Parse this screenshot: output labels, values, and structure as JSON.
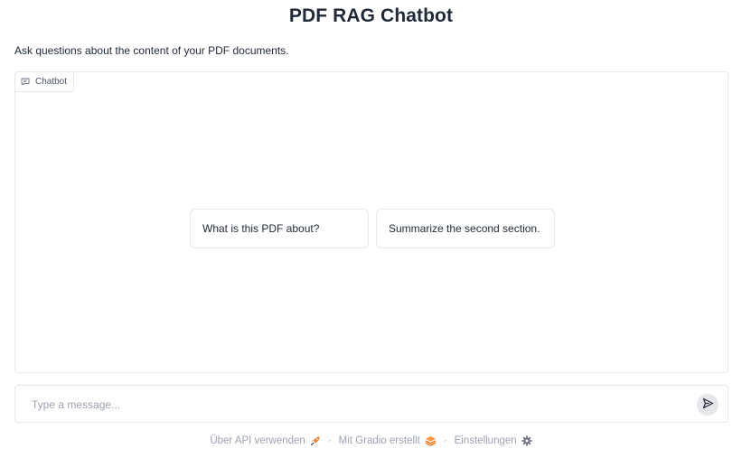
{
  "header": {
    "title": "PDF RAG Chatbot",
    "description": "Ask questions about the content of your PDF documents."
  },
  "chatbot": {
    "label": "Chatbot",
    "label_icon": "chat-bubble-icon",
    "examples": [
      "What is this PDF about?",
      "Summarize the second section."
    ]
  },
  "composer": {
    "placeholder": "Type a message...",
    "value": "",
    "send_icon": "send-icon"
  },
  "footer": {
    "api_label": "Über API verwenden",
    "api_icon": "rocket-icon",
    "separator": "·",
    "gradio_label": "Mit Gradio erstellt",
    "gradio_icon": "gradio-logo-icon",
    "settings_label": "Einstellungen",
    "settings_icon": "gear-icon"
  },
  "colors": {
    "border": "#e5e7eb",
    "text": "#1f2937",
    "muted": "#9ca3af",
    "accent_orange": "#f97316"
  }
}
